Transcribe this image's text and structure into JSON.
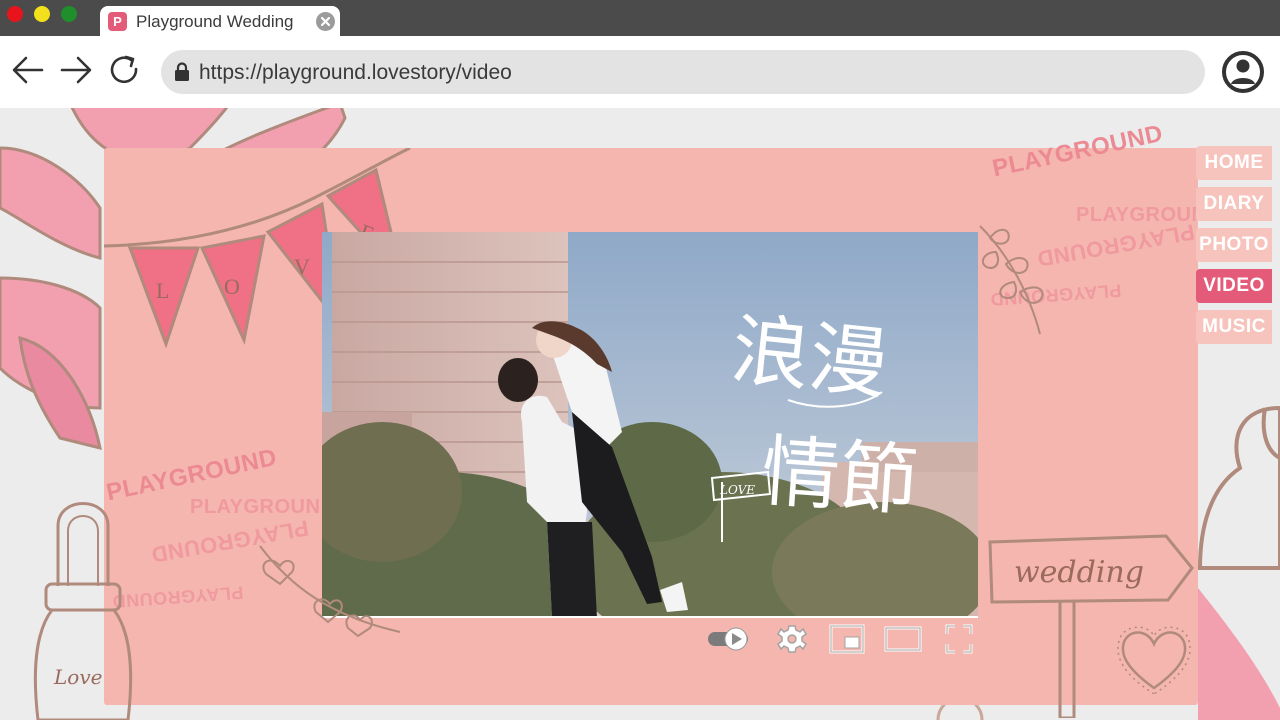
{
  "browser": {
    "tab_title": "Playground Wedding",
    "favicon_letter": "P",
    "url": "https://playground.lovestory/video"
  },
  "nav": {
    "items": [
      {
        "label": "HOME",
        "active": false
      },
      {
        "label": "DIARY",
        "active": false
      },
      {
        "label": "PHOTO",
        "active": false
      },
      {
        "label": "VIDEO",
        "active": true
      },
      {
        "label": "MUSIC",
        "active": false
      }
    ]
  },
  "watermarks": {
    "playground": "PLAYGROUND",
    "playgroun": "PLAYGROUN"
  },
  "decor": {
    "banner_letters": [
      "L",
      "O",
      "V",
      "E"
    ],
    "flag_text": "LOVE",
    "jar_text": "Love",
    "sign_text": "wedding"
  },
  "video": {
    "title_calligraphy": "浪漫情節",
    "title_line1": "浪漫",
    "title_line2": "情節"
  },
  "colors": {
    "frame": "#f4b6ae",
    "accent": "#e45b79",
    "nav_idle": "#f7c3bd",
    "line_brown": "#b08a7c"
  },
  "icons": {
    "back": "arrow-left-icon",
    "forward": "arrow-right-icon",
    "reload": "reload-icon",
    "lock": "lock-icon",
    "profile": "user-icon",
    "toggle": "autoplay-toggle-icon",
    "settings": "gear-icon",
    "miniplayer": "miniplayer-icon",
    "theater": "theater-mode-icon",
    "fullscreen": "fullscreen-icon"
  }
}
